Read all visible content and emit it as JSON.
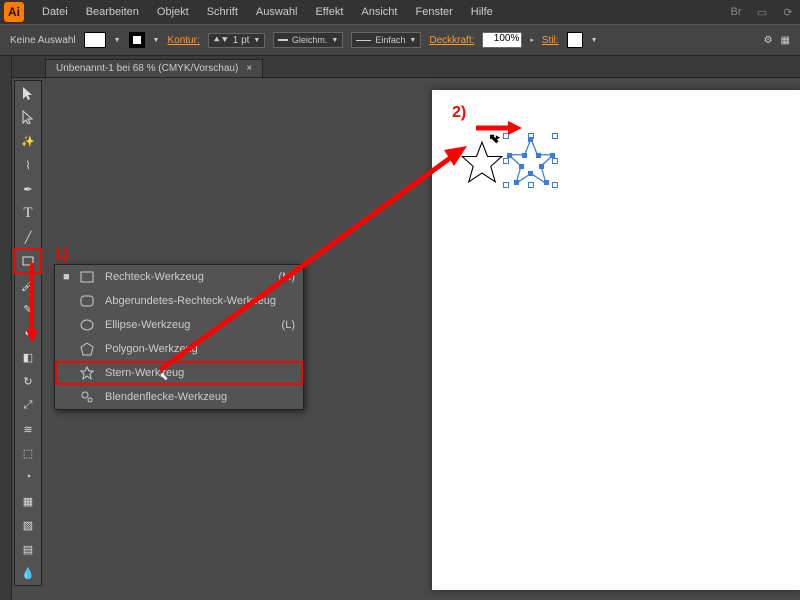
{
  "app_icon": "Ai",
  "menu": [
    "Datei",
    "Bearbeiten",
    "Objekt",
    "Schrift",
    "Auswahl",
    "Effekt",
    "Ansicht",
    "Fenster",
    "Hilfe"
  ],
  "controlbar": {
    "selection_label": "Keine Auswahl",
    "kontur_label": "Kontur:",
    "kontur_value": "1 pt",
    "brush1": "Gleichm.",
    "brush2": "Einfach",
    "opacity_label": "Deckkraft:",
    "opacity_value": "100%",
    "stil_label": "Stil:"
  },
  "tab": {
    "title": "Unbenannt-1 bei 68 % (CMYK/Vorschau)",
    "close": "×"
  },
  "flyout": {
    "items": [
      {
        "label": "Rechteck-Werkzeug",
        "shortcut": "(M)",
        "icon": "rect"
      },
      {
        "label": "Abgerundetes-Rechteck-Werkzeug",
        "shortcut": "",
        "icon": "roundrect"
      },
      {
        "label": "Ellipse-Werkzeug",
        "shortcut": "(L)",
        "icon": "ellipse"
      },
      {
        "label": "Polygon-Werkzeug",
        "shortcut": "",
        "icon": "polygon"
      },
      {
        "label": "Stern-Werkzeug",
        "shortcut": "",
        "icon": "star"
      },
      {
        "label": "Blendenflecke-Werkzeug",
        "shortcut": "",
        "icon": "flare"
      }
    ],
    "selected_index": 4
  },
  "annotations": {
    "step1": "1)",
    "step2": "2)"
  },
  "tools": [
    "selection",
    "direct",
    "wand",
    "lasso",
    "pen",
    "type",
    "line",
    "rect",
    "brush",
    "pencil",
    "blob",
    "eraser",
    "rotate",
    "scale",
    "width",
    "freetransform",
    "shapebuilder",
    "perspective",
    "mesh",
    "gradient",
    "eyedrop",
    "blend",
    "symbol",
    "graph",
    "artboard",
    "slice",
    "hand",
    "zoom"
  ]
}
